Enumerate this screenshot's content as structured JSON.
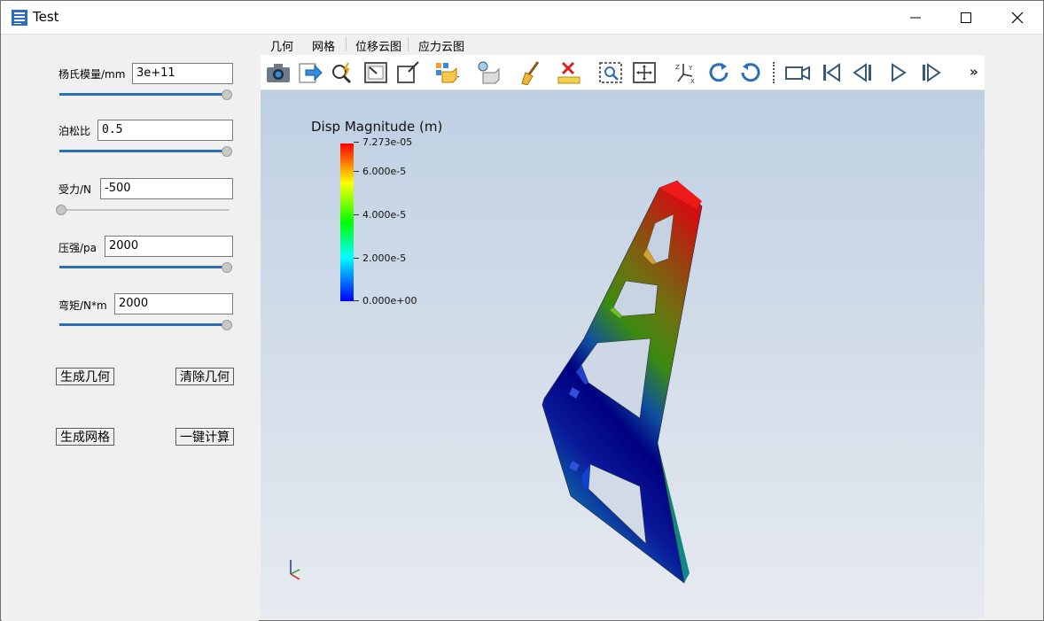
{
  "window": {
    "title": "Test"
  },
  "params": [
    {
      "label": "杨氏模量/mm",
      "value": "3e+11",
      "slider_fraction": 1.0
    },
    {
      "label": "泊松比",
      "value": "0.5",
      "slider_fraction": 1.0
    },
    {
      "label": "受力/N",
      "value": "-500",
      "slider_fraction": 0.0
    },
    {
      "label": "压强/pa",
      "value": "2000",
      "slider_fraction": 1.0
    },
    {
      "label": "弯矩/N*m",
      "value": "2000",
      "slider_fraction": 1.0
    }
  ],
  "buttons": {
    "generate_geometry": "生成几何",
    "clear_geometry": "清除几何",
    "generate_mesh": "生成网格",
    "one_click_compute": "一键计算"
  },
  "tabs": [
    "几何",
    "网格",
    "位移云图",
    "应力云图"
  ],
  "toolbar": {
    "icons": [
      "camera-icon",
      "export-icon",
      "zoom-query-icon",
      "reset-camera-icon",
      "zoom-to-box-icon",
      "representation-icon",
      "light-icon",
      "clear-icon",
      "delete-ruler-icon",
      "select-zoom-icon",
      "pan-fit-icon",
      "axes-orientation-icon",
      "rotate-cw-icon",
      "rotate-ccw-icon",
      "video-camera-icon",
      "first-frame-icon",
      "previous-frame-icon",
      "play-icon",
      "next-frame-icon"
    ],
    "overflow": "»"
  },
  "viewport": {
    "legend_title": "Disp Magnitude (m)",
    "legend_ticks": [
      "7.273e-05",
      "6.000e-5",
      "4.000e-5",
      "2.000e-5",
      "0.000e+00"
    ],
    "legend_colors": {
      "min": "#0000ff",
      "max": "#ff0000"
    }
  }
}
